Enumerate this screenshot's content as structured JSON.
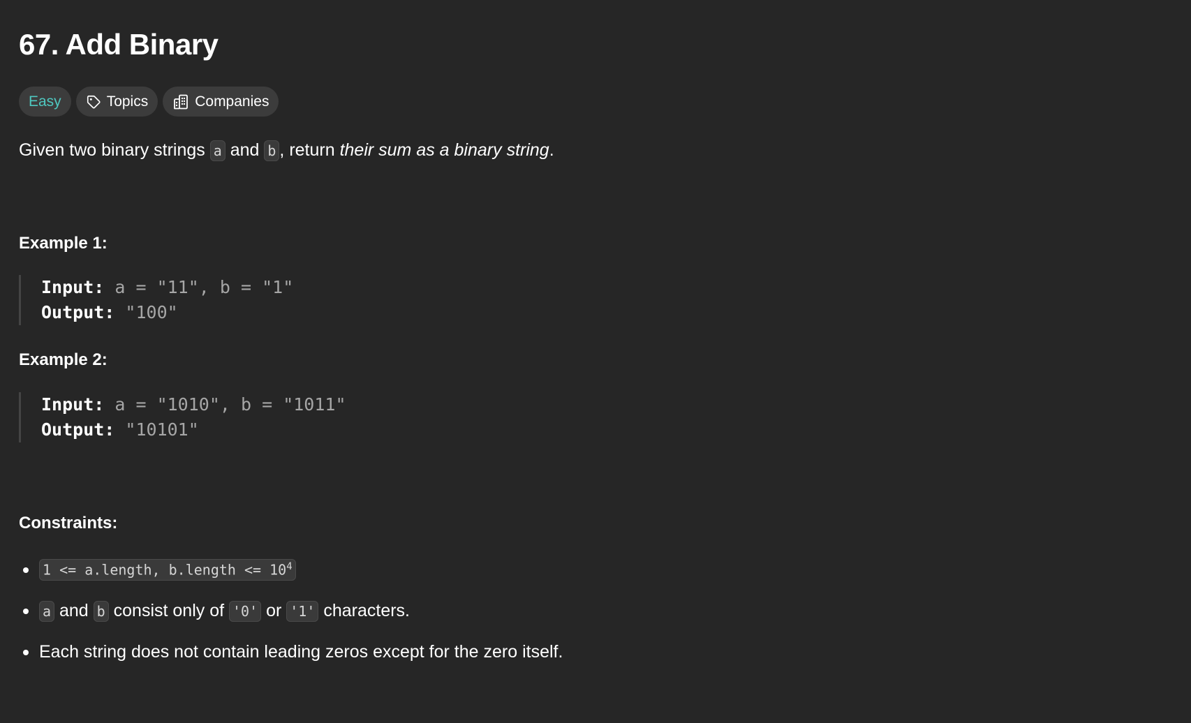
{
  "problem": {
    "title": "67. Add Binary",
    "difficulty": "Easy",
    "topics_label": "Topics",
    "companies_label": "Companies"
  },
  "description": {
    "prefix": "Given two binary strings ",
    "var_a": "a",
    "and1": " and ",
    "var_b": "b",
    "mid": ", return ",
    "emph": "their sum as a binary string",
    "suffix": "."
  },
  "examples": [
    {
      "title": "Example 1:",
      "input_label": "Input:",
      "input_value": "a = \"11\", b = \"1\"",
      "output_label": "Output:",
      "output_value": "\"100\""
    },
    {
      "title": "Example 2:",
      "input_label": "Input:",
      "input_value": "a = \"1010\", b = \"1011\"",
      "output_label": "Output:",
      "output_value": "\"10101\""
    }
  ],
  "constraints": {
    "title": "Constraints:",
    "c1_code": "1 <= a.length, b.length <= 10",
    "c1_sup": "4",
    "c2_a": "a",
    "c2_and": " and ",
    "c2_b": "b",
    "c2_mid": " consist only of ",
    "c2_zero": "'0'",
    "c2_or": " or ",
    "c2_one": "'1'",
    "c2_end": " characters.",
    "c3": "Each string does not contain leading zeros except for the zero itself."
  },
  "colors": {
    "background": "#262626",
    "easy": "#4fc8c0",
    "tag_bg": "#3c3c3c",
    "muted_code": "#a6a6a6"
  },
  "icons": [
    "tag-icon",
    "building-icon"
  ]
}
